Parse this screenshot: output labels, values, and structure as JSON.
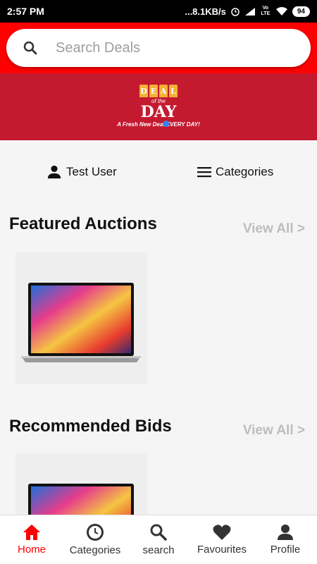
{
  "status": {
    "time": "2:57 PM",
    "speed": "...8.1KB/s",
    "battery": "94",
    "volte": "Vo LTE"
  },
  "search": {
    "placeholder": "Search Deals"
  },
  "banner": {
    "tag_letters": [
      "D",
      "E",
      "A",
      "L"
    ],
    "of_the": "of the",
    "day": "DAY",
    "tagline": "A Fresh New Deal EVERY DAY!"
  },
  "user_row": {
    "user_label": "Test User",
    "categories_label": "Categories"
  },
  "sections": {
    "featured": {
      "title": "Featured Auctions",
      "view_all": "View All >"
    },
    "recommended": {
      "title": "Recommended Bids",
      "view_all": "View All >"
    }
  },
  "nav": {
    "items": [
      {
        "label": "Home",
        "icon": "home-icon"
      },
      {
        "label": "Categories",
        "icon": "clock-icon"
      },
      {
        "label": "search",
        "icon": "search-icon"
      },
      {
        "label": "Favourites",
        "icon": "heart-icon"
      },
      {
        "label": "Profile",
        "icon": "person-icon"
      }
    ],
    "active": "Home"
  },
  "colors": {
    "brand_red": "#ff0000",
    "banner_red": "#c41a30",
    "muted": "#bdbdbd"
  }
}
